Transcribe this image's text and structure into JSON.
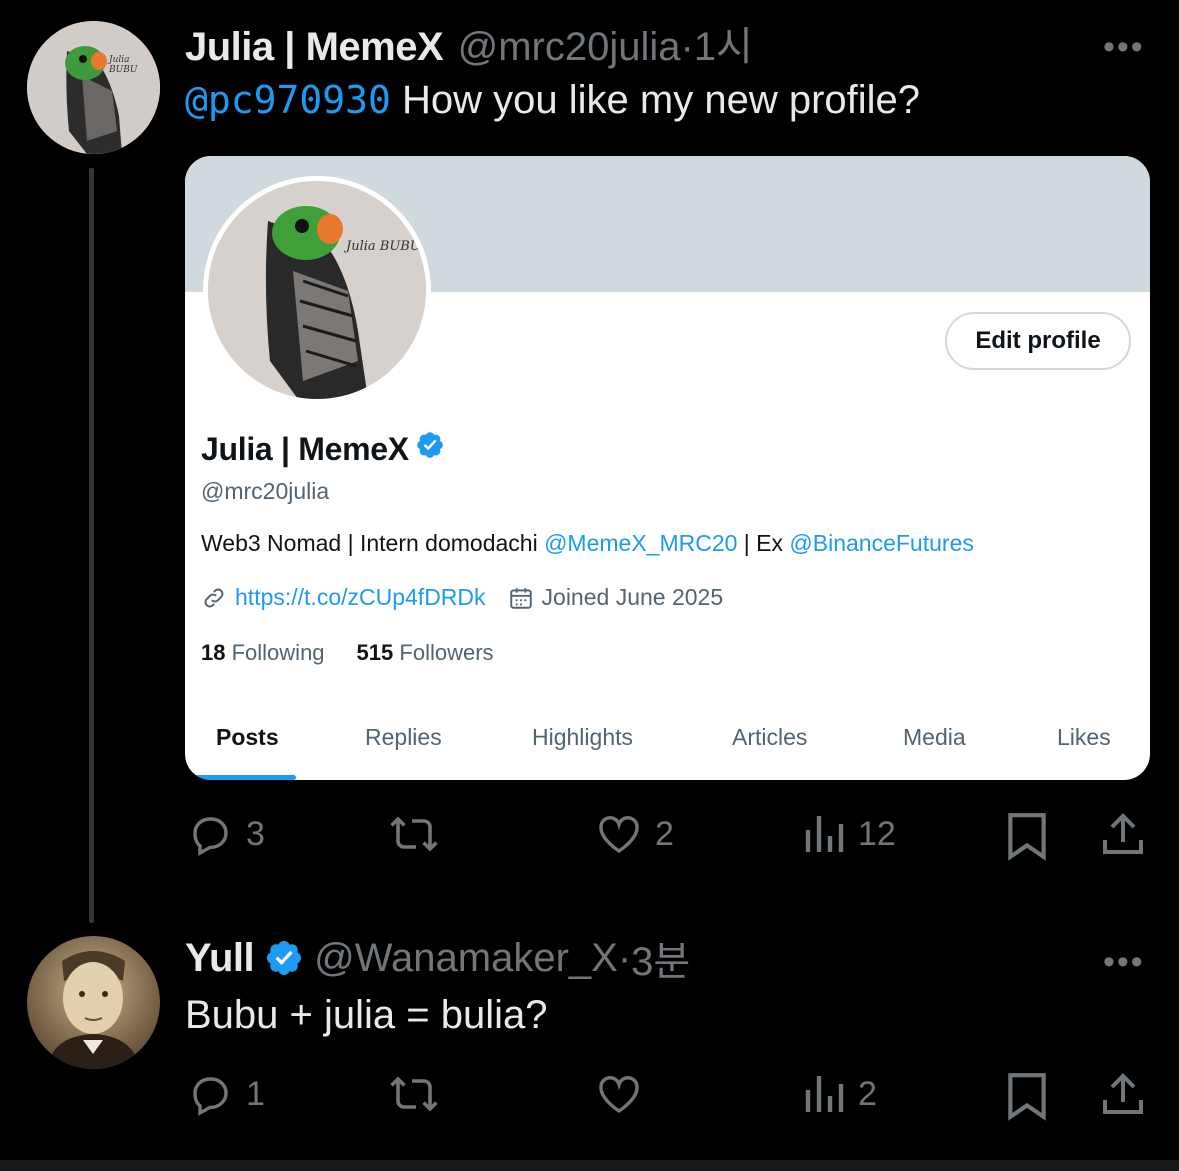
{
  "tweet1": {
    "name": "Julia | MemeX",
    "handle": "@mrc20julia",
    "separator": "·",
    "time": "1시",
    "more": "•••",
    "mention": "@pc970930",
    "text": " How you like my new profile?",
    "actions": {
      "replies": "3",
      "retweets": "",
      "likes": "2",
      "views": "12"
    }
  },
  "profile_card": {
    "edit_label": "Edit profile",
    "name": "Julia | MemeX",
    "handle": "@mrc20julia",
    "bio_prefix": "Web3 Nomad | Intern domodachi ",
    "bio_mention1": "@MemeX_MRC20",
    "bio_middle": " | Ex ",
    "bio_mention2": "@BinanceFutures",
    "link": "https://t.co/zCUp4fDRDk",
    "joined": "Joined June 2025",
    "following_count": "18",
    "following_label": "Following",
    "followers_count": "515",
    "followers_label": "Followers",
    "avatar_signature": "Julia BUBU",
    "tabs": [
      "Posts",
      "Replies",
      "Highlights",
      "Articles",
      "Media",
      "Likes"
    ],
    "active_tab": "Posts"
  },
  "tweet2": {
    "name": "Yull",
    "handle": "@Wanamaker_X",
    "separator": "·",
    "time": "3분",
    "more": "•••",
    "text": "Bubu + julia = bulia?",
    "actions": {
      "replies": "1",
      "retweets": "",
      "likes": "",
      "views": "2"
    }
  },
  "colors": {
    "background": "#000000",
    "accent": "#1d9bf0",
    "muted": "#71767b",
    "text": "#e7e9ea"
  },
  "icons": [
    "reply-icon",
    "retweet-icon",
    "like-icon",
    "views-icon",
    "bookmark-icon",
    "share-icon",
    "verified-icon",
    "link-icon",
    "calendar-icon",
    "more-icon"
  ]
}
